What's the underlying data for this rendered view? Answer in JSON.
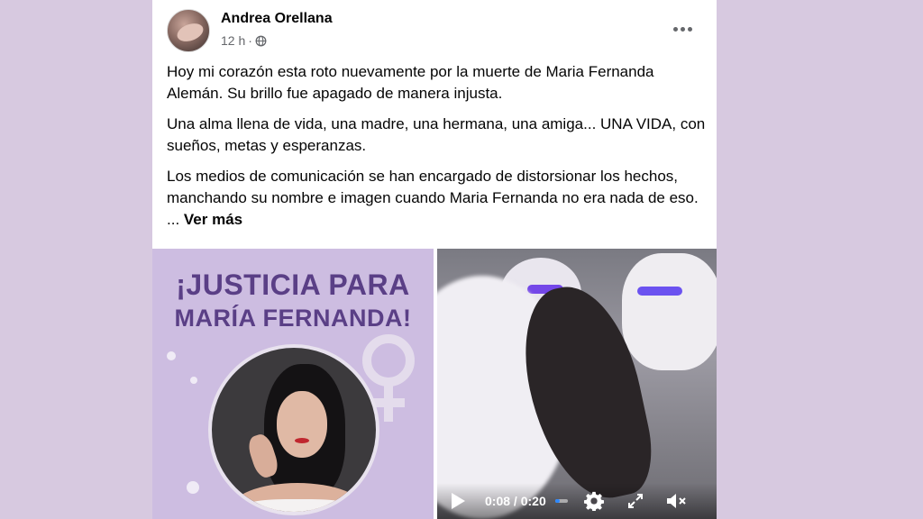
{
  "post": {
    "author": "Andrea Orellana",
    "time": "12 h",
    "separator": "·",
    "paragraphs": [
      "Hoy mi corazón esta roto nuevamente por la muerte de Maria Fernanda Alemán. Su brillo fue apagado de manera injusta.",
      "Una alma llena de vida, una madre, una hermana, una amiga... UNA VIDA, con sueños, metas y esperanzas.",
      "Los medios de comunicación se han encargado de distorsionar los hechos, manchando su nombre e imagen cuando Maria Fernanda no era nada de eso. ..."
    ],
    "see_more": "Ver más"
  },
  "image": {
    "headline_line1": "¡JUSTICIA PARA",
    "headline_line2": "MARÍA FERNANDA!"
  },
  "video": {
    "current_time": "0:08",
    "time_sep": "/",
    "duration": "0:20",
    "progress": 0.4
  },
  "colors": {
    "background": "#d7c9e0",
    "headline": "#5a3f86",
    "progress": "#2d88ff"
  },
  "icons": [
    "globe-icon",
    "more-icon",
    "venus-icon",
    "play-icon",
    "gear-icon",
    "fullscreen-icon",
    "mute-icon"
  ]
}
